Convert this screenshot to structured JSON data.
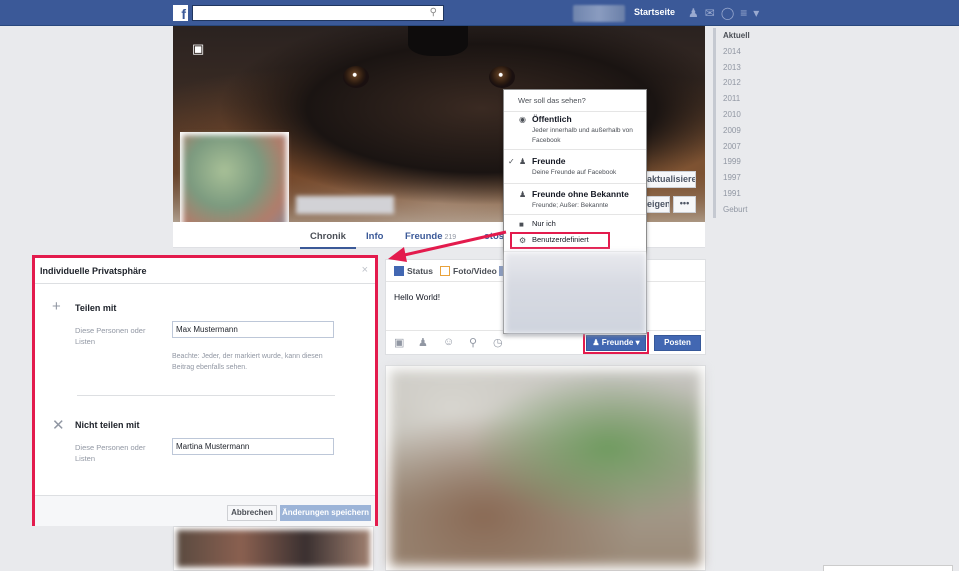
{
  "topbar": {
    "logo": "f",
    "search_placeholder": "",
    "home_label": "Startseite",
    "nav_icons": [
      "friends-icon",
      "messages-icon",
      "globe-icon",
      "settings-icon"
    ]
  },
  "profile": {
    "update_button": "aktualisieren",
    "show_button": "eigen",
    "more_button": "•••"
  },
  "tabs": [
    {
      "label": "Chronik"
    },
    {
      "label": "Info"
    },
    {
      "label": "Freunde",
      "count": "219"
    },
    {
      "label": "otos"
    }
  ],
  "timeline_years": [
    "Aktuell",
    "2014",
    "2013",
    "2012",
    "2011",
    "2010",
    "2009",
    "2007",
    "1999",
    "1997",
    "1991",
    "Geburt"
  ],
  "composer": {
    "tab_status": "Status",
    "tab_photo": "Foto/Video",
    "text": "Hello World!",
    "audience_button": "Freunde ▾",
    "post_button": "Posten"
  },
  "privacy_menu": {
    "header": "Wer soll das sehen?",
    "public_title": "Öffentlich",
    "public_desc": "Jeder innerhalb und außerhalb von Facebook",
    "friends_title": "Freunde",
    "friends_desc": "Deine Freunde auf Facebook",
    "friends_except_title": "Freunde ohne Bekannte",
    "friends_except_desc": "Freunde; Außer: Bekannte",
    "only_me": "Nur ich",
    "custom": "Benutzerdefiniert"
  },
  "custom_privacy_dialog": {
    "title": "Individuelle Privatsphäre",
    "close": "×",
    "share_with_title": "Teilen mit",
    "share_with_label": "Diese Personen oder Listen",
    "share_with_value": "Max Mustermann",
    "share_note": "Beachte: Jeder, der markiert wurde, kann diesen Beitrag ebenfalls sehen.",
    "dont_share_title": "Nicht teilen mit",
    "dont_share_label": "Diese Personen oder Listen",
    "dont_share_value": "Martina Mustermann",
    "cancel_button": "Abbrechen",
    "save_button": "Änderungen speichern"
  },
  "colors": {
    "brand": "#3b5998",
    "highlight": "#e31b4d",
    "button": "#4267b2"
  }
}
